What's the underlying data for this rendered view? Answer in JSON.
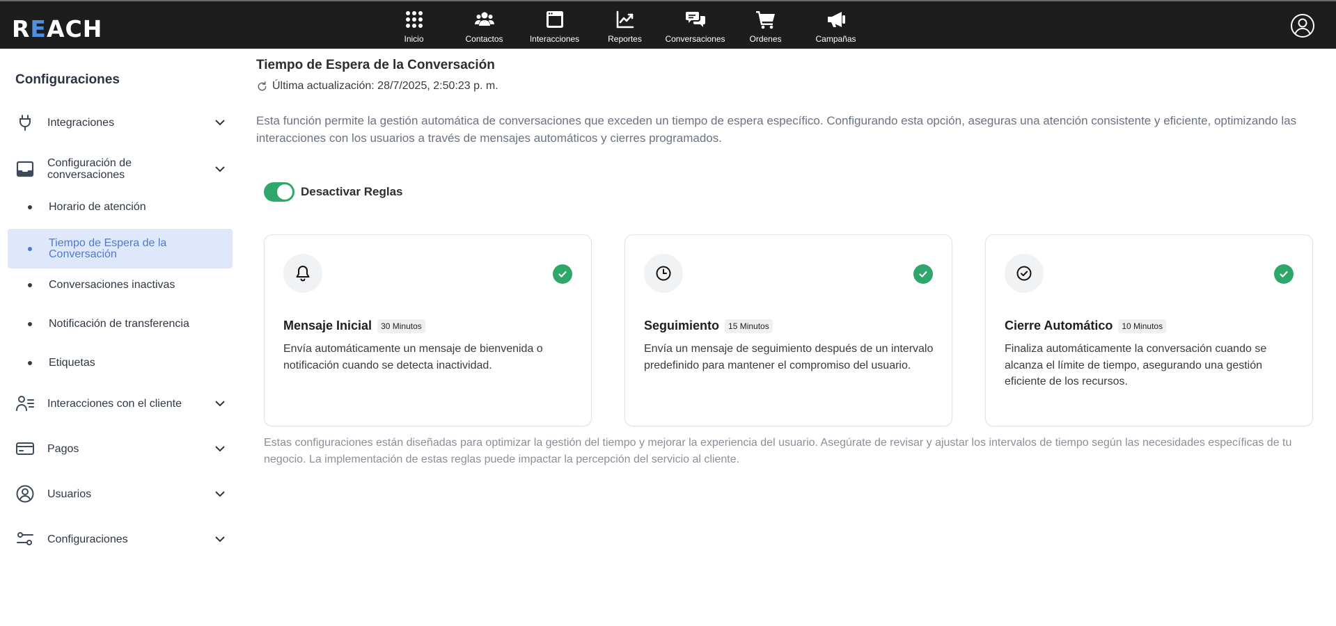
{
  "app": {
    "logo": "REACH"
  },
  "nav": [
    {
      "label": "Inicio",
      "icon": "grid-dots-icon"
    },
    {
      "label": "Contactos",
      "icon": "users-icon"
    },
    {
      "label": "Interacciones",
      "icon": "browser-window-icon"
    },
    {
      "label": "Reportes",
      "icon": "chart-line-icon"
    },
    {
      "label": "Conversaciones",
      "icon": "chat-bubbles-icon"
    },
    {
      "label": "Ordenes",
      "icon": "shopping-cart-icon"
    },
    {
      "label": "Campañas",
      "icon": "megaphone-icon"
    }
  ],
  "sidebar": {
    "title": "Configuraciones",
    "sections": {
      "integraciones": "Integraciones",
      "config_conversaciones": "Configuración de conversaciones",
      "interacciones_cliente": "Interacciones con el cliente",
      "pagos": "Pagos",
      "usuarios": "Usuarios",
      "configuraciones": "Configuraciones"
    },
    "subitems": {
      "horario": "Horario de atención",
      "tiempo_espera": "Tiempo de Espera de la Conversación",
      "inactivas": "Conversaciones inactivas",
      "transferencia": "Notificación de transferencia",
      "etiquetas": "Etiquetas"
    }
  },
  "main": {
    "title": "Tiempo de Espera de la Conversación",
    "last_updated": "Última actualización: 28/7/2025, 2:50:23 p. m.",
    "description": "Esta función permite la gestión automática de conversaciones que exceden un tiempo de espera específico. Configurando esta opción, aseguras una atención consistente y eficiente, optimizando las interacciones con los usuarios a través de mensajes automáticos y cierres programados.",
    "toggle_label": "Desactivar Reglas",
    "toggle_on": true,
    "cards": [
      {
        "title": "Mensaje Inicial",
        "badge": "30 Minutos",
        "text": "Envía automáticamente un mensaje de bienvenida o notificación cuando se detecta inactividad.",
        "icon": "bell-icon"
      },
      {
        "title": "Seguimiento",
        "badge": "15 Minutos",
        "text": "Envía un mensaje de seguimiento después de un intervalo predefinido para mantener el compromiso del usuario.",
        "icon": "clock-icon"
      },
      {
        "title": "Cierre Automático",
        "badge": "10 Minutos",
        "text": "Finaliza automáticamente la conversación cuando se alcanza el límite de tiempo, asegurando una gestión eficiente de los recursos.",
        "icon": "check-circle-icon"
      }
    ],
    "note": "Estas configuraciones están diseñadas para optimizar la gestión del tiempo y mejorar la experiencia del usuario. Asegúrate de revisar y ajustar los intervalos de tiempo según las necesidades específicas de tu negocio. La implementación de estas reglas puede impactar la percepción del servicio al cliente."
  },
  "colors": {
    "topbar": "#1d1d1d",
    "accent_blue": "#4d7ad8",
    "active_bg": "#dfe8fb",
    "success_green": "#2ea76a"
  }
}
